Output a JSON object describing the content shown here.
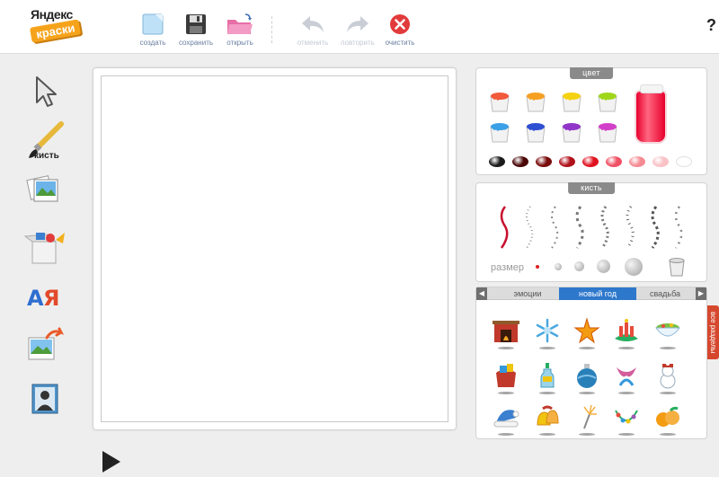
{
  "logo": {
    "line1": "Яндекс",
    "line2": "краски"
  },
  "toolbar": {
    "create": "создать",
    "save": "сохранить",
    "open": "открыть",
    "undo": "отменить",
    "redo": "повторить",
    "clear": "очистить",
    "help": "?"
  },
  "tools": {
    "brush_label": "кисть"
  },
  "color_panel": {
    "title": "цвет",
    "paint_colors": [
      "#f25a3b",
      "#f6a023",
      "#f4d20f",
      "#9fd61c",
      "#3ba0e6",
      "#2f4fd2",
      "#9136c8",
      "#d23fc9"
    ],
    "selected_color": "#e8002d",
    "shade_colors": [
      "#1b1b1b",
      "#4a0606",
      "#7a0b0b",
      "#b0101a",
      "#e0121f",
      "#f05064",
      "#f58a93",
      "#f8c2c6",
      "#ffffff"
    ]
  },
  "brush_panel": {
    "title": "кисть",
    "size_label": "размер"
  },
  "stickers_panel": {
    "categories": [
      "эмоции",
      "новый год",
      "свадьба"
    ],
    "active_category": "новый год",
    "all_sections": "все разделы"
  }
}
